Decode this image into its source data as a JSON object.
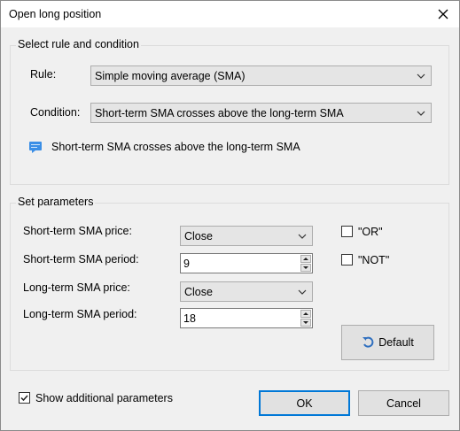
{
  "window": {
    "title": "Open long position"
  },
  "rule_group": {
    "title": "Select rule and condition",
    "rule_label": "Rule:",
    "rule_value": "Simple moving average (SMA)",
    "condition_label": "Condition:",
    "condition_value": "Short-term SMA crosses above the long-term SMA",
    "info_text": "Short-term SMA crosses above the long-term SMA"
  },
  "params_group": {
    "title": "Set parameters",
    "short_price_label": "Short-term SMA price:",
    "short_price_value": "Close",
    "short_period_label": "Short-term SMA period:",
    "short_period_value": "9",
    "long_price_label": "Long-term SMA price:",
    "long_price_value": "Close",
    "long_period_label": "Long-term SMA period:",
    "long_period_value": "18",
    "or_label": "\"OR\"",
    "not_label": "\"NOT\"",
    "default_button": "Default"
  },
  "footer": {
    "show_additional_label": "Show additional parameters",
    "show_additional_checked": true,
    "ok_button": "OK",
    "cancel_button": "Cancel"
  },
  "icons": {
    "close": "close-icon",
    "chevron": "chevron-down-icon",
    "info": "message-icon",
    "reset": "undo-icon"
  },
  "colors": {
    "accent": "#0078d7",
    "info_icon": "#3a8ee6"
  }
}
